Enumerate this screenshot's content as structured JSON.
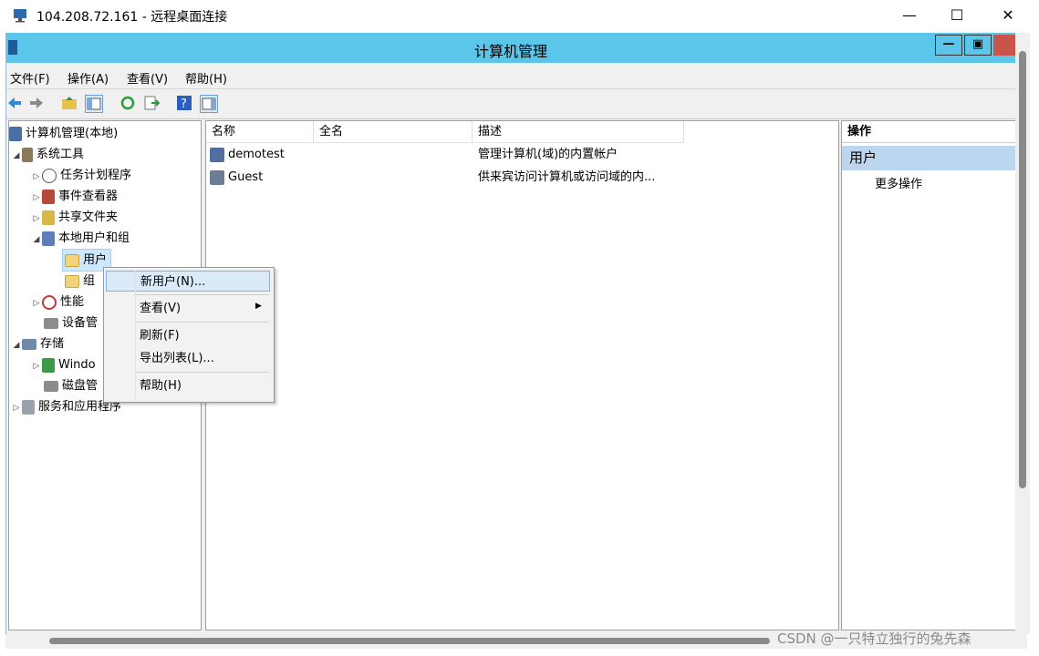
{
  "rdp": {
    "title": "104.208.72.161 - 远程桌面连接",
    "minimize": "—",
    "maximize": "☐",
    "close": "✕"
  },
  "window": {
    "title": "计算机管理"
  },
  "menubar": [
    "文件(F)",
    "操作(A)",
    "查看(V)",
    "帮助(H)"
  ],
  "tree": {
    "root": "计算机管理(本地)",
    "system_tools": "系统工具",
    "task_scheduler": "任务计划程序",
    "event_viewer": "事件查看器",
    "shared_folders": "共享文件夹",
    "local_users_groups": "本地用户和组",
    "users": "用户",
    "groups": "组",
    "performance": "性能",
    "device_manager": "设备管",
    "storage": "存储",
    "windows_backup": "Windo",
    "disk_management": "磁盘管",
    "services_apps": "服务和应用程序"
  },
  "list": {
    "headers": [
      "名称",
      "全名",
      "描述"
    ],
    "rows": [
      {
        "name": "demotest",
        "fullname": "",
        "desc": "管理计算机(域)的内置帐户"
      },
      {
        "name": "Guest",
        "fullname": "",
        "desc": "供来宾访问计算机或访问域的内..."
      }
    ]
  },
  "actions": {
    "header": "操作",
    "section": "用户",
    "more": "更多操作"
  },
  "context_menu": {
    "new_user": "新用户(N)...",
    "view": "查看(V)",
    "refresh": "刷新(F)",
    "export": "导出列表(L)...",
    "help": "帮助(H)"
  },
  "watermark": "CSDN @一只特立独行的兔先森",
  "colors": {
    "title_bar": "#5bc6ea",
    "selection": "#cce8ff",
    "action_header": "#bcd6ef"
  }
}
